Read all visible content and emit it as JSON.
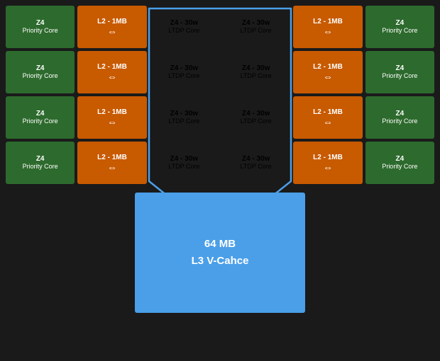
{
  "colors": {
    "green": "#2d6a2d",
    "orange": "#c85a00",
    "blue": "#4a9fe8",
    "ltdp_blue": "#3a7abd",
    "bg": "#1a1a1a"
  },
  "grid": {
    "rows": [
      [
        {
          "type": "green",
          "line1": "Z4",
          "line2": "Priority Core"
        },
        {
          "type": "orange",
          "line1": "L2 - 1MB",
          "arrow": true
        },
        {
          "type": "ltdp_blue",
          "line1": "Z4 - 30w",
          "line2": "LTDP Core"
        },
        {
          "type": "ltdp_blue",
          "line1": "Z4 - 30w",
          "line2": "LTDP Core"
        },
        {
          "type": "orange",
          "line1": "L2 - 1MB",
          "arrow": true
        },
        {
          "type": "green",
          "line1": "Z4",
          "line2": "Priority Core"
        }
      ],
      [
        {
          "type": "green",
          "line1": "Z4",
          "line2": "Priority Core"
        },
        {
          "type": "orange",
          "line1": "L2 - 1MB",
          "arrow": true
        },
        {
          "type": "ltdp_blue",
          "line1": "Z4 - 30w",
          "line2": "LTDP Core"
        },
        {
          "type": "ltdp_blue",
          "line1": "Z4 - 30w",
          "line2": "LTDP Core"
        },
        {
          "type": "orange",
          "line1": "L2 - 1MB",
          "arrow": true
        },
        {
          "type": "green",
          "line1": "Z4",
          "line2": "Priority Core"
        }
      ],
      [
        {
          "type": "green",
          "line1": "Z4",
          "line2": "Priority Core"
        },
        {
          "type": "orange",
          "line1": "L2 - 1MB",
          "arrow": true
        },
        {
          "type": "ltdp_blue",
          "line1": "Z4 - 30w",
          "line2": "LTDP Core"
        },
        {
          "type": "ltdp_blue",
          "line1": "Z4 - 30w",
          "line2": "LTDP Core"
        },
        {
          "type": "orange",
          "line1": "L2 - 1MB",
          "arrow": true
        },
        {
          "type": "green",
          "line1": "Z4",
          "line2": "Priority Core"
        }
      ],
      [
        {
          "type": "green",
          "line1": "Z4",
          "line2": "Priority Core"
        },
        {
          "type": "orange",
          "line1": "L2 - 1MB",
          "arrow": true
        },
        {
          "type": "ltdp_blue",
          "line1": "Z4 - 30w",
          "line2": "LTDP Core"
        },
        {
          "type": "ltdp_blue",
          "line1": "Z4 - 30w",
          "line2": "LTDP Core"
        },
        {
          "type": "orange",
          "line1": "L2 - 1MB",
          "arrow": true
        },
        {
          "type": "green",
          "line1": "Z4",
          "line2": "Priority Core"
        }
      ]
    ],
    "l3": {
      "line1": "64 MB",
      "line2": "L3 V-Cahce"
    }
  }
}
